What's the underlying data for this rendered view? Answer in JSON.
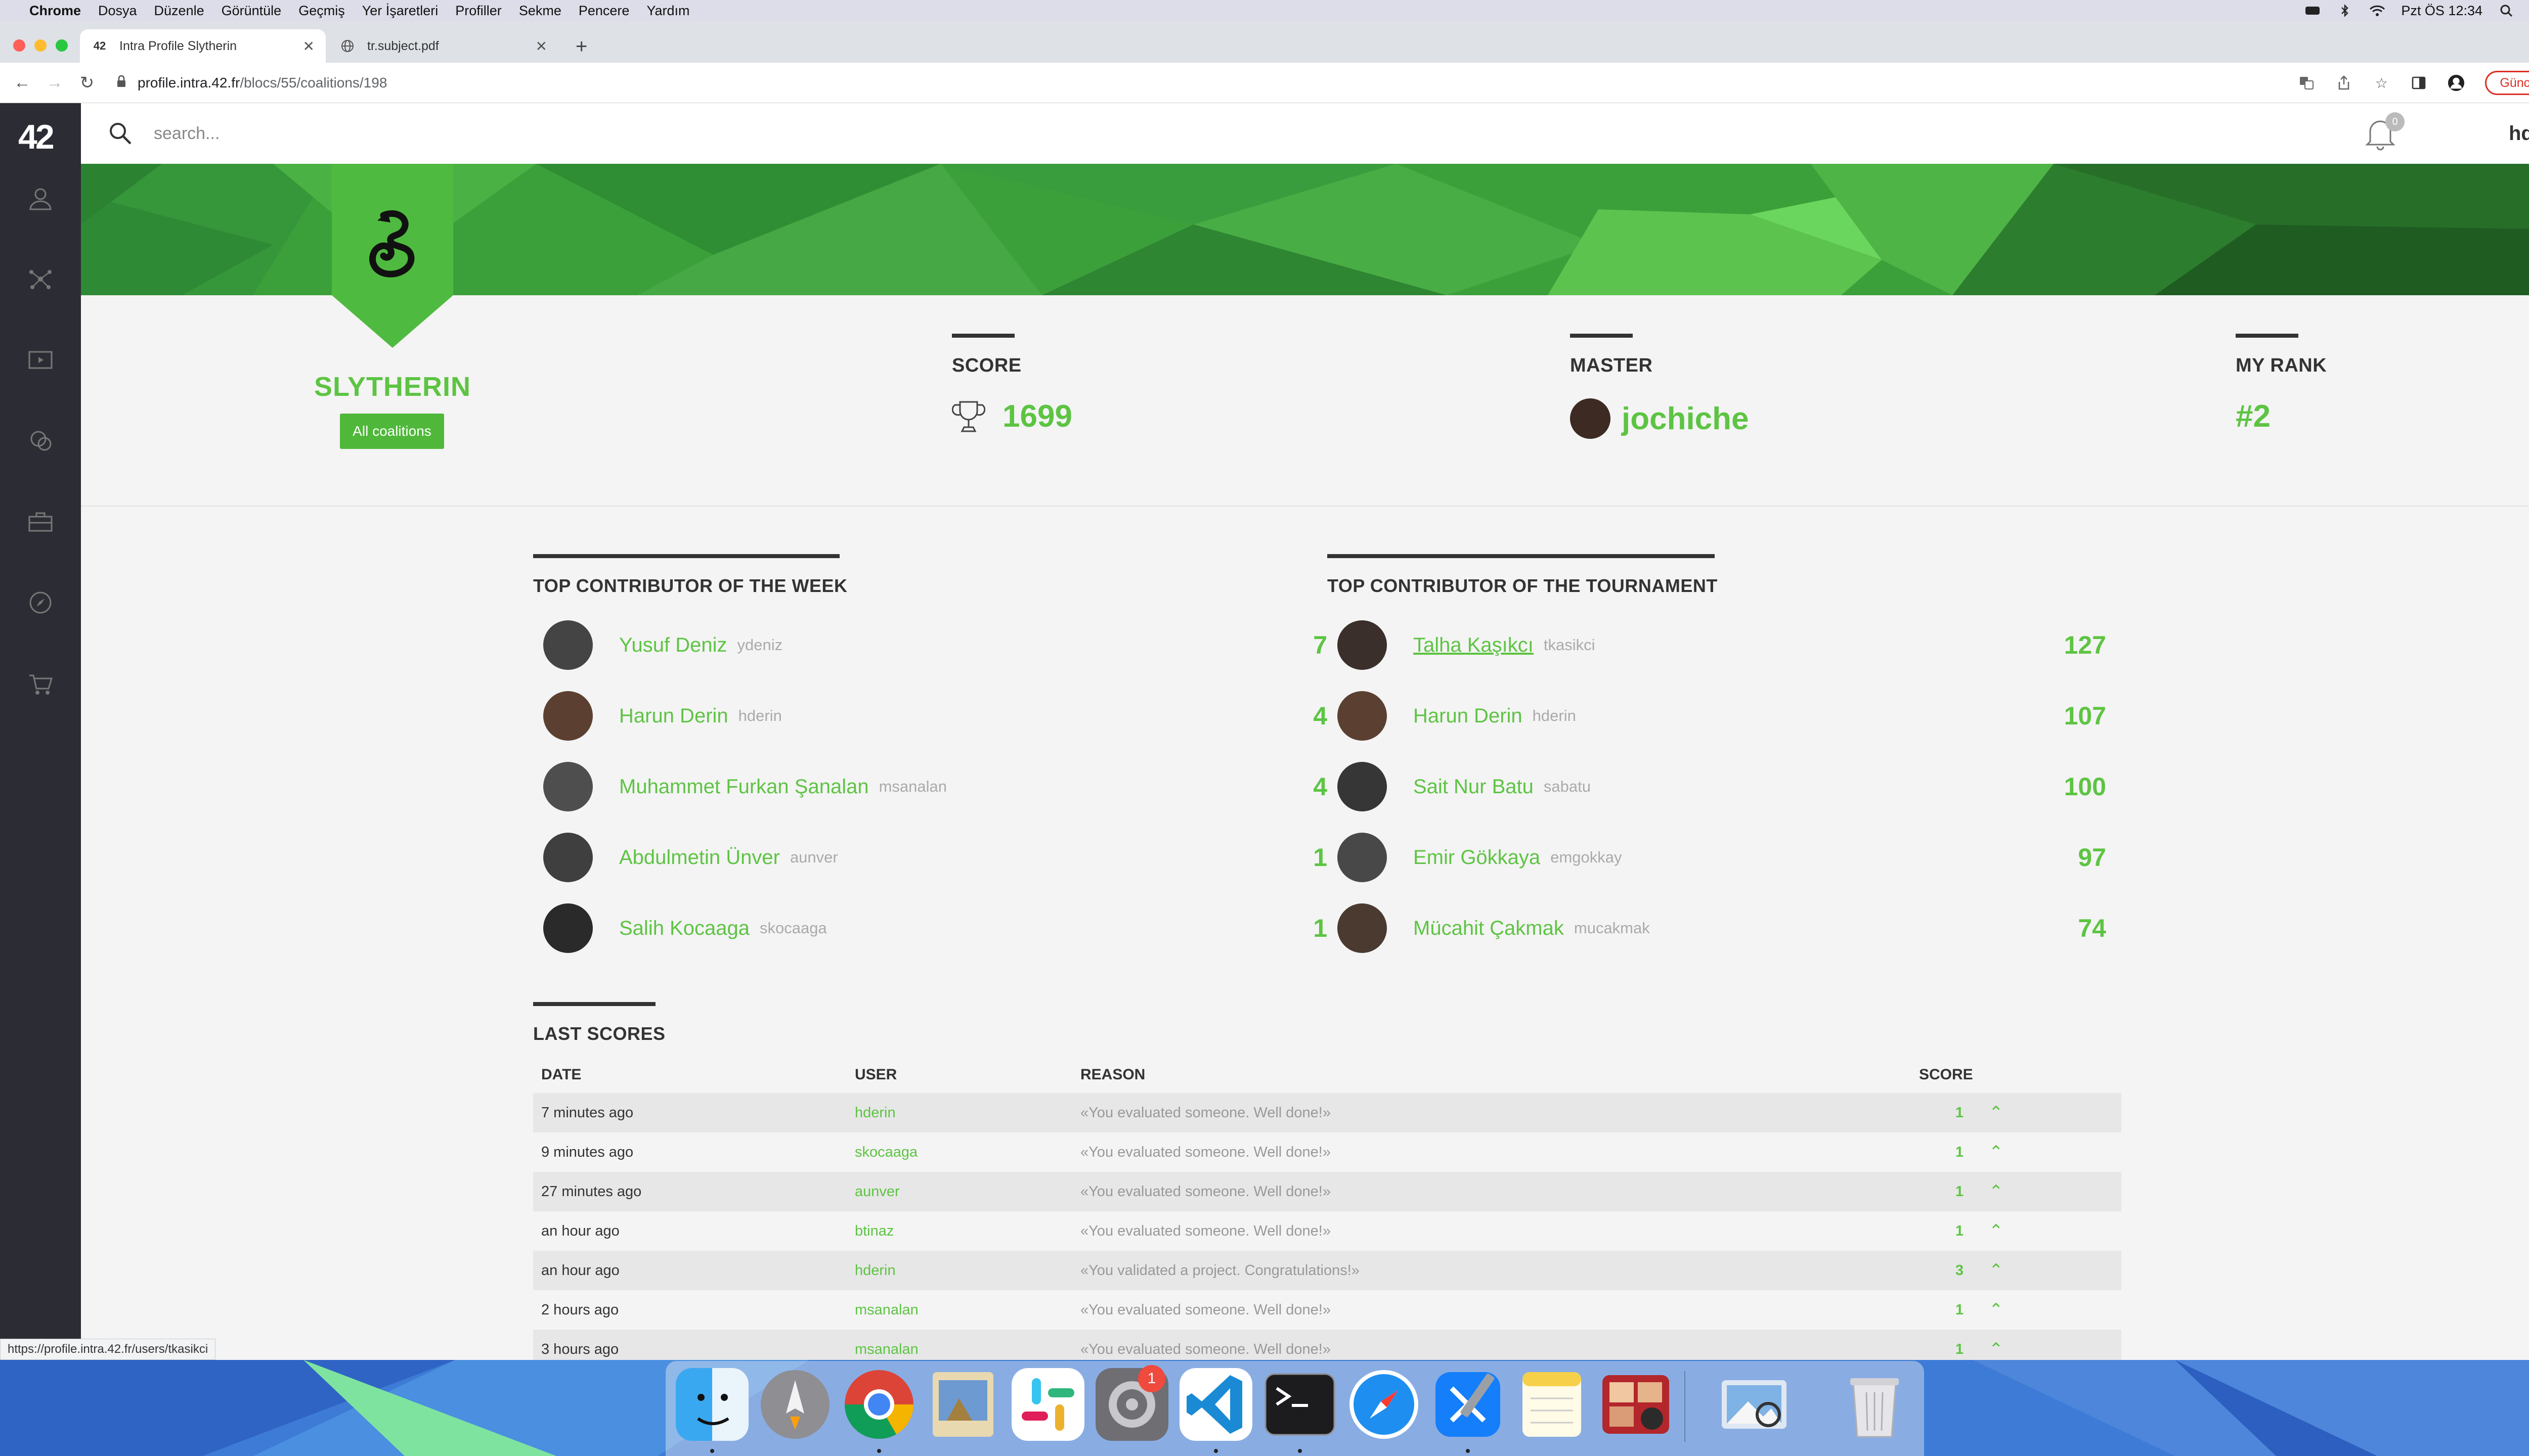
{
  "menubar": {
    "items": [
      "Chrome",
      "Dosya",
      "Düzenle",
      "Görüntüle",
      "Geçmiş",
      "Yer İşaretleri",
      "Profiller",
      "Sekme",
      "Pencere",
      "Yardım"
    ],
    "clock": "Pzt ÖS 12:34"
  },
  "browser": {
    "tabs": [
      {
        "title": "Intra Profile Slytherin",
        "favicon": "42"
      },
      {
        "title": "tr.subject.pdf"
      }
    ],
    "url_host": "profile.intra.42.fr",
    "url_path": "/blocs/55/coalitions/198",
    "update_label": "Güncelle",
    "status_link": "https://profile.intra.42.fr/users/tkasikci"
  },
  "header": {
    "logo": "42",
    "search_placeholder": "search...",
    "notification_count": "0",
    "username": "hderin"
  },
  "coalition": {
    "name": "SLYTHERIN",
    "all_coalitions_label": "All coalitions",
    "score_label": "SCORE",
    "score": "1699",
    "master_label": "MASTER",
    "master": "jochiche",
    "rank_label": "MY RANK",
    "rank": "#2",
    "accent": "#5dc443"
  },
  "week": {
    "title": "TOP CONTRIBUTOR OF THE WEEK",
    "rows": [
      {
        "name": "Yusuf Deniz",
        "login": "ydeniz",
        "score": "7"
      },
      {
        "name": "Harun Derin",
        "login": "hderin",
        "score": "4"
      },
      {
        "name": "Muhammet Furkan Şanalan",
        "login": "msanalan",
        "score": "4"
      },
      {
        "name": "Abdulmetin Ünver",
        "login": "aunver",
        "score": "1"
      },
      {
        "name": "Salih Kocaaga",
        "login": "skocaaga",
        "score": "1"
      }
    ]
  },
  "tournament": {
    "title": "TOP CONTRIBUTOR OF THE TOURNAMENT",
    "rows": [
      {
        "name": "Talha Kaşıkcı",
        "login": "tkasikci",
        "score": "127"
      },
      {
        "name": "Harun Derin",
        "login": "hderin",
        "score": "107"
      },
      {
        "name": "Sait Nur Batu",
        "login": "sabatu",
        "score": "100"
      },
      {
        "name": "Emir Gökkaya",
        "login": "emgokkay",
        "score": "97"
      },
      {
        "name": "Mücahit Çakmak",
        "login": "mucakmak",
        "score": "74"
      }
    ]
  },
  "last_scores": {
    "title": "LAST SCORES",
    "columns": {
      "date": "DATE",
      "user": "USER",
      "reason": "REASON",
      "score": "SCORE"
    },
    "rows": [
      {
        "date": "7 minutes ago",
        "user": "hderin",
        "reason": "«You evaluated someone. Well done!»",
        "score": "1"
      },
      {
        "date": "9 minutes ago",
        "user": "skocaaga",
        "reason": "«You evaluated someone. Well done!»",
        "score": "1"
      },
      {
        "date": "27 minutes ago",
        "user": "aunver",
        "reason": "«You evaluated someone. Well done!»",
        "score": "1"
      },
      {
        "date": "an hour ago",
        "user": "btinaz",
        "reason": "«You evaluated someone. Well done!»",
        "score": "1"
      },
      {
        "date": "an hour ago",
        "user": "hderin",
        "reason": "«You validated a project. Congratulations!»",
        "score": "3"
      },
      {
        "date": "2 hours ago",
        "user": "msanalan",
        "reason": "«You evaluated someone. Well done!»",
        "score": "1"
      },
      {
        "date": "3 hours ago",
        "user": "msanalan",
        "reason": "«You evaluated someone. Well done!»",
        "score": "1"
      }
    ]
  },
  "dock": {
    "apps": [
      "finder-icon",
      "launchpad-icon",
      "chrome-icon",
      "preview-icon",
      "slack-icon",
      "system-preferences-icon",
      "vscode-icon",
      "terminal-icon",
      "safari-icon",
      "xcode-icon",
      "notes-icon",
      "photo-booth-icon",
      "image-viewer-icon",
      "trash-icon"
    ],
    "system_preferences_badge": "1"
  }
}
